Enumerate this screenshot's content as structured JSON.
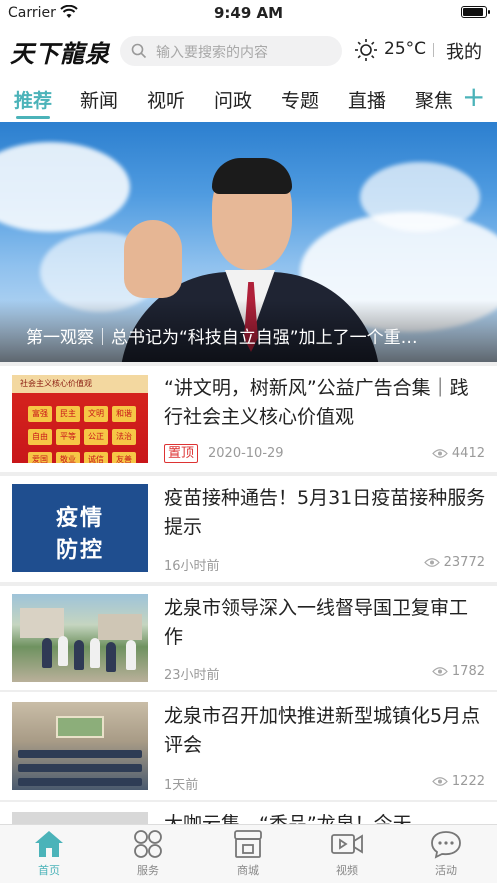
{
  "status_bar": {
    "carrier": "Carrier",
    "time": "9:49 AM"
  },
  "header": {
    "logo": "天下龍泉",
    "search_placeholder": "输入要搜索的内容",
    "temperature": "25°C",
    "mine": "我的"
  },
  "tabs": [
    "推荐",
    "新闻",
    "视听",
    "问政",
    "专题",
    "直播",
    "聚焦"
  ],
  "active_tab": "推荐",
  "hero": {
    "caption": "第一观察｜总书记为“科技自立自强”加上了一个重…"
  },
  "news": [
    {
      "title": "“讲文明，树新风”公益广告合集｜践行社会主义核心价值观",
      "badge": "置顶",
      "time": "2020-10-29",
      "views": "4412",
      "thumb_header": "社会主义核心价值观",
      "thumb_cells": [
        "富强",
        "民主",
        "文明",
        "和谐",
        "自由",
        "平等",
        "公正",
        "法治",
        "爱国",
        "敬业",
        "诚信",
        "友善"
      ]
    },
    {
      "title": "疫苗接种通告！5月31日疫苗接种服务提示",
      "time": "16小时前",
      "views": "23772",
      "thumb_lines": [
        "疫情",
        "防控"
      ]
    },
    {
      "title": "龙泉市领导深入一线督导国卫复审工作",
      "time": "23小时前",
      "views": "1782"
    },
    {
      "title": "龙泉市召开加快推进新型城镇化5月点评会",
      "time": "1天前",
      "views": "1222"
    },
    {
      "title": "大咖云集，“香品”龙泉！今天…"
    }
  ],
  "tabbar": [
    {
      "label": "首页",
      "icon": "home-icon"
    },
    {
      "label": "服务",
      "icon": "grid-circles-icon"
    },
    {
      "label": "商城",
      "icon": "shop-icon"
    },
    {
      "label": "视频",
      "icon": "video-icon"
    },
    {
      "label": "活动",
      "icon": "chat-bubble-icon"
    }
  ],
  "colors": {
    "accent": "#4bb3b9",
    "badge": "#dd3333"
  }
}
